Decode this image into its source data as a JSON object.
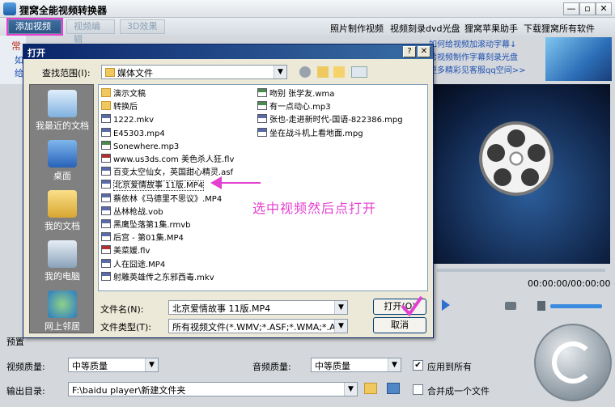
{
  "app": {
    "title": "狸窝全能视频转换器",
    "minimize": "—",
    "restore": "▫",
    "close": "✕"
  },
  "toolbar": {
    "add_video": "添加视频",
    "edit_video": "视频编辑",
    "effect_3d": "3D效果",
    "links": [
      "照片制作视频",
      "视频刻录dvd光盘",
      "狸窝苹果助手",
      "下载狸窝所有软件"
    ]
  },
  "side_tabs": [
    "常",
    "如",
    "给"
  ],
  "promo": [
    "如何给视频加滚动字幕↓",
    "给视频制作字幕刻录光盘",
    "更多精彩见客服qq空间>>"
  ],
  "player": {
    "time": "00:00:00/00:00:00"
  },
  "settings": {
    "preset_label": "预置",
    "video_quality_label": "视频质量:",
    "video_quality": "中等质量",
    "audio_quality_label": "音频质量:",
    "audio_quality": "中等质量",
    "apply_all": "应用到所有",
    "output_label": "输出目录:",
    "output_path": "F:\\baidu player\\新建文件夹",
    "merge": "合并成一个文件"
  },
  "dialog": {
    "title": "打开",
    "lookin_label": "查找范围(I):",
    "lookin_value": "媒体文件",
    "places": [
      "我最近的文档",
      "桌面",
      "我的文档",
      "我的电脑",
      "网上邻居"
    ],
    "files_left": [
      {
        "name": "演示文稿",
        "type": "fold"
      },
      {
        "name": "转换后",
        "type": "fold"
      },
      {
        "name": "1222.mkv",
        "type": "vid"
      },
      {
        "name": "E45303.mp4",
        "type": "vid"
      },
      {
        "name": "Sonewhere.mp3",
        "type": "mp3"
      },
      {
        "name": "www.us3ds.com 美色杀人狂.flv",
        "type": "flv"
      },
      {
        "name": "百变太空仙女，英国甜心精灵.asf",
        "type": "vid"
      },
      {
        "name": "北京爱情故事 11版.MP4",
        "type": "vid"
      },
      {
        "name": "蔡依林《马德里不思议》.MP4",
        "type": "vid"
      },
      {
        "name": "丛林枪战.vob",
        "type": "vid"
      },
      {
        "name": "黑鹰坠落第1集.rmvb",
        "type": "vid"
      },
      {
        "name": "后宫 - 第01集.MP4",
        "type": "vid"
      },
      {
        "name": "美菜媛.flv",
        "type": "flv"
      },
      {
        "name": "人在囧途.MP4",
        "type": "vid"
      },
      {
        "name": "射雕英雄传之东邪西毒.mkv",
        "type": "vid"
      }
    ],
    "files_right": [
      {
        "name": "吻别 张学友.wma",
        "type": "mp3"
      },
      {
        "name": "有一点动心.mp3",
        "type": "mp3"
      },
      {
        "name": "张也-走进新时代-国语-822386.mpg",
        "type": "vid"
      },
      {
        "name": "坐在战斗机上看地面.mpg",
        "type": "vid"
      }
    ],
    "filename_label": "文件名(N):",
    "filename_value": "北京爱情故事 11版.MP4",
    "filetype_label": "文件类型(T):",
    "filetype_value": "所有视频文件(*.WMV;*.ASF;*.WMA;*.AVI;*",
    "open_button": "打开(O)",
    "cancel_button": "取消"
  },
  "annotation": "选中视频然后点打开",
  "colors": {
    "highlight": "#e43fd0",
    "dialog_title": "#0a246a"
  }
}
